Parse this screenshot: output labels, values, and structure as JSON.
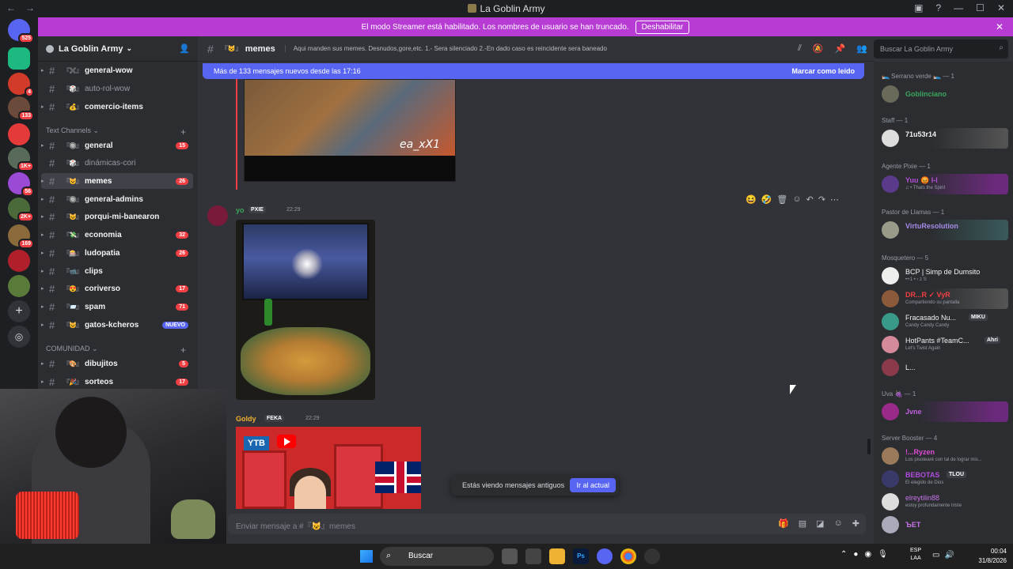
{
  "window": {
    "title": "La Goblin Army",
    "nav_back": "←",
    "nav_forward": "→"
  },
  "guild_badges": [
    "525",
    "4",
    "133",
    "1K+",
    "56",
    "2K+",
    "169"
  ],
  "banner": {
    "text": "El modo Streamer está habilitado. Los nombres de usuario se han truncado.",
    "button": "Deshabilitar",
    "color": "#b63cd4"
  },
  "server": {
    "name": "La Goblin Army",
    "channels_top": [
      {
        "emoji": "『✖️』",
        "name": "general-wow",
        "unread": true
      },
      {
        "emoji": "『🎲』",
        "name": "auto-rol-wow",
        "unread": false
      },
      {
        "emoji": "『💰』",
        "name": "comercio-items",
        "unread": true
      }
    ],
    "category_text": "Text Channels",
    "channels_text": [
      {
        "emoji": "『🔘』",
        "name": "general",
        "count": "15",
        "unread": true
      },
      {
        "emoji": "『🎲』",
        "name": "dinámicas-cori",
        "count": "",
        "unread": false
      },
      {
        "emoji": "『😺』",
        "name": "memes",
        "count": "26",
        "unread": true,
        "selected": true
      },
      {
        "emoji": "『🔘』",
        "name": "general-admins",
        "count": "",
        "unread": true
      },
      {
        "emoji": "『😺』",
        "name": "porqui-mi-banearon",
        "count": "",
        "unread": true
      },
      {
        "emoji": "『💸』",
        "name": "economia",
        "count": "32",
        "unread": true
      },
      {
        "emoji": "『🎰』",
        "name": "ludopatia",
        "count": "26",
        "unread": true
      },
      {
        "emoji": "『📹』",
        "name": "clips",
        "count": "",
        "unread": true
      },
      {
        "emoji": "『😍』",
        "name": "coriverso",
        "count": "17",
        "unread": true
      },
      {
        "emoji": "『📨』",
        "name": "spam",
        "count": "71",
        "unread": true
      },
      {
        "emoji": "『😺』",
        "name": "gatos-kcheros",
        "count": "NUEVO",
        "unread": true
      }
    ],
    "category_comunidad": "COMUNIDAD",
    "channels_comunidad": [
      {
        "emoji": "『🎨』",
        "name": "dibujitos",
        "count": "5",
        "unread": true
      },
      {
        "emoji": "『🎉』",
        "name": "sorteos",
        "count": "17",
        "unread": true
      }
    ]
  },
  "channel_header": {
    "emoji": "『😺』",
    "name": "memes",
    "topic": "Aqui manden sus memes. Desnudos,gore,etc. 1.- Sera silenciado 2.-En dado caso es reincidente sera baneado"
  },
  "search": {
    "placeholder": "Buscar La Goblin Army"
  },
  "new_messages": {
    "text": "Más de 133 mensajes nuevos desde las 17:16",
    "mark_read": "Marcar como leído"
  },
  "messages": [
    {
      "author": "yo",
      "tag": "PXIE",
      "time": "22:29",
      "color": "#3ba55c"
    },
    {
      "author": "Goldy",
      "tag": "FEKA",
      "time": "22:29",
      "color": "#f0b232"
    }
  ],
  "image1_caption": "ea_xX1",
  "youtube_label": "YTB",
  "old_messages": {
    "text": "Estás viendo mensajes antiguos",
    "button": "Ir al actual"
  },
  "composer": {
    "placeholder": "Enviar mensaje a #『😺』memes"
  },
  "members": {
    "groups": [
      {
        "label": "🛌 Serrano verde 🛌 — 1"
      },
      {
        "label": "Staff — 1"
      },
      {
        "label": "Agente Pixie — 1"
      },
      {
        "label": "Pastor de Llamas — 1"
      },
      {
        "label": "Mosquetero — 5"
      },
      {
        "label": "Uva 🍇 — 1"
      },
      {
        "label": "Server Booster — 4"
      }
    ],
    "list": [
      {
        "name": "Goblinciano",
        "status": "",
        "color": "#3ba55c"
      },
      {
        "name": "71u53r14",
        "status": "",
        "color": "#f2f3f5"
      },
      {
        "name": "Yuu 😡 I-I",
        "status": "♫ • Thats the Spirit",
        "color": "#b64fd6"
      },
      {
        "name": "VirtuResolution",
        "status": "",
        "color": "#a78be8"
      },
      {
        "name": "BCP | Simp de Dumsito",
        "status": "•+1 • ‹ z S",
        "color": "#f2f3f5"
      },
      {
        "name": "DR...R ✓ VyR",
        "status": "Compartiendo su pantalla",
        "color": "#f23f43"
      },
      {
        "name": "Fracasado Nu...",
        "status": "Candy Candy Candy",
        "color": "#f2f3f5"
      },
      {
        "name": "HotPants #TeamC...",
        "status": "Let's Twist Again",
        "color": "#f2f3f5"
      },
      {
        "name": "L...",
        "status": "",
        "color": "#f2f3f5"
      },
      {
        "name": "Jvne",
        "status": "",
        "color": "#c25ede"
      },
      {
        "name": "!...Ryzen",
        "status": "Los pisotearé con tal de lograr mis...",
        "color": "#e04bd7"
      },
      {
        "name": "BEBOTAS",
        "status": "El elegido de Dios",
        "color": "#b04be0"
      },
      {
        "name": "elreytilin88",
        "status": "estoy profundamente triste",
        "color": "#c774e8"
      },
      {
        "name": "ЪET",
        "status": "",
        "color": "#c774e8"
      }
    ],
    "tags": {
      "vyr": "VyR",
      "miku": "MIKU",
      "ahri": "Ahri",
      "tlou": "TLOU"
    }
  },
  "taskbar": {
    "search": "Buscar",
    "lang1": "ESP",
    "lang2": "LAA",
    "time": "00:04",
    "date": "31/8/2026"
  }
}
